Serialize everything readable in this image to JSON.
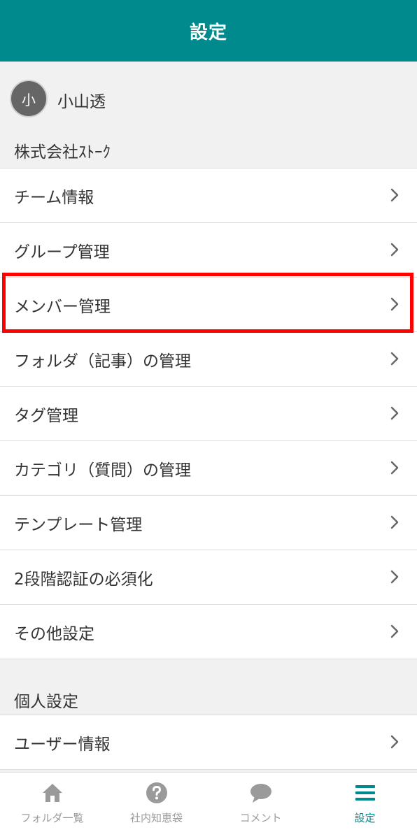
{
  "header": {
    "title": "設定"
  },
  "user": {
    "avatar_initial": "小",
    "name": "小山透"
  },
  "company": {
    "name": "株式会社ｽﾄｰｸ"
  },
  "team_settings": {
    "items": [
      {
        "label": "チーム情報"
      },
      {
        "label": "グループ管理"
      },
      {
        "label": "メンバー管理"
      },
      {
        "label": "フォルダ（記事）の管理"
      },
      {
        "label": "タグ管理"
      },
      {
        "label": "カテゴリ（質問）の管理"
      },
      {
        "label": "テンプレート管理"
      },
      {
        "label": "2段階認証の必須化"
      },
      {
        "label": "その他設定"
      }
    ]
  },
  "personal_settings": {
    "title": "個人設定",
    "items": [
      {
        "label": "ユーザー情報"
      }
    ]
  },
  "tabbar": {
    "tabs": [
      {
        "label": "フォルダ一覧",
        "icon": "home-icon"
      },
      {
        "label": "社内知恵袋",
        "icon": "question-icon"
      },
      {
        "label": "コメント",
        "icon": "comment-icon"
      },
      {
        "label": "設定",
        "icon": "menu-icon",
        "active": true
      }
    ]
  },
  "colors": {
    "accent": "#008a8e",
    "highlight": "#ff0000",
    "inactive": "#9a9a9a"
  }
}
